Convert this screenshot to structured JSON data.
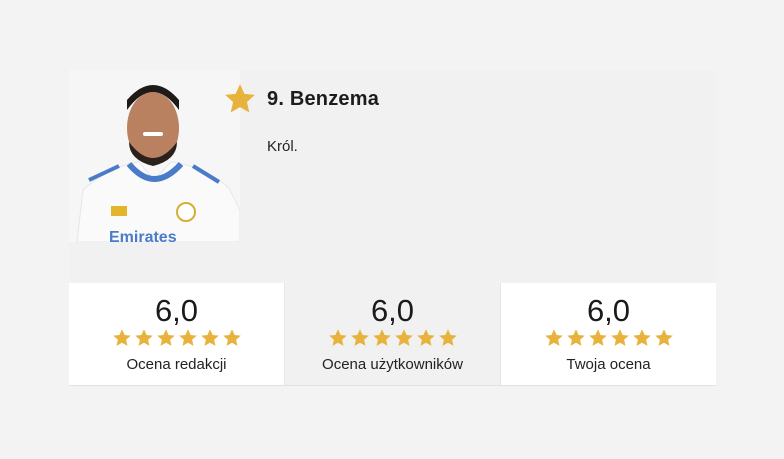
{
  "player": {
    "number_name": "9. Benzema",
    "description": "Król.",
    "photo_text": "Emirates",
    "highlight_icon": "star-icon"
  },
  "colors": {
    "star": "#e8b33c",
    "card_bg": "#f1f1f1",
    "page_bg": "#f3f3f3"
  },
  "ratings": [
    {
      "value": "6,0",
      "label": "Ocena redakcji",
      "stars": 6
    },
    {
      "value": "6,0",
      "label": "Ocena użytkowników",
      "stars": 6
    },
    {
      "value": "6,0",
      "label": "Twoja ocena",
      "stars": 6
    }
  ]
}
